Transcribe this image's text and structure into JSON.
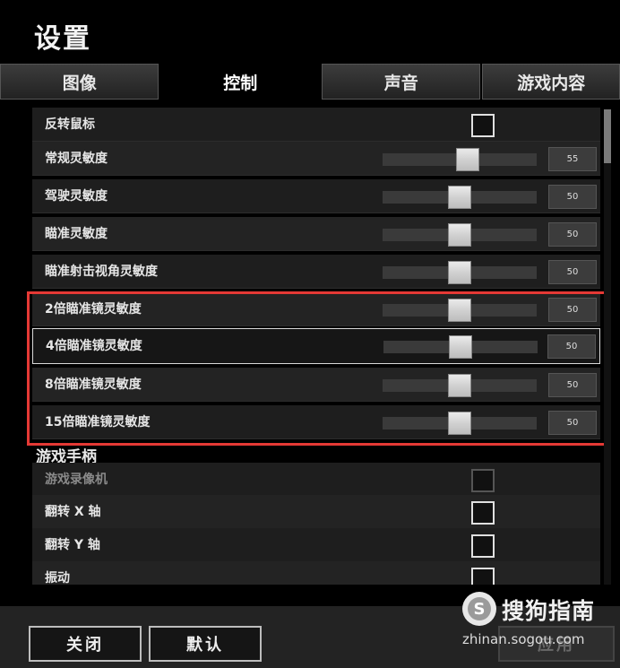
{
  "window": {
    "title": "设置"
  },
  "tabs": [
    {
      "label": "图像",
      "active": false
    },
    {
      "label": "控制",
      "active": true
    },
    {
      "label": "声音",
      "active": false
    },
    {
      "label": "游戏内容",
      "active": false
    }
  ],
  "settings": {
    "invert_mouse": {
      "label": "反转鼠标"
    },
    "general_sensitivity": {
      "label": "常规灵敏度",
      "value": "55",
      "fraction": 0.55
    },
    "driving_sensitivity": {
      "label": "驾驶灵敏度",
      "value": "50",
      "fraction": 0.5
    },
    "aim_sensitivity": {
      "label": "瞄准灵敏度",
      "value": "50",
      "fraction": 0.5
    },
    "ads_sensitivity": {
      "label": "瞄准射击视角灵敏度",
      "value": "50",
      "fraction": 0.5
    },
    "scope_2x": {
      "label": "2倍瞄准镜灵敏度",
      "value": "50",
      "fraction": 0.5
    },
    "scope_4x": {
      "label": "4倍瞄准镜灵敏度",
      "value": "50",
      "fraction": 0.5
    },
    "scope_8x": {
      "label": "8倍瞄准镜灵敏度",
      "value": "50",
      "fraction": 0.5
    },
    "scope_15x": {
      "label": "15倍瞄准镜灵敏度",
      "value": "50",
      "fraction": 0.5
    }
  },
  "gamepad": {
    "title": "游戏手柄",
    "recorder": {
      "label": "游戏录像机"
    },
    "flip_x": {
      "label": "翻转 X 轴"
    },
    "flip_y": {
      "label": "翻转 Y 轴"
    },
    "vibration": {
      "label": "振动"
    }
  },
  "buttons": {
    "close": "关闭",
    "default": "默认",
    "apply": "应用"
  },
  "watermark": {
    "name": "搜狗指南",
    "url": "zhinan.sogou.com",
    "logo_letter": "S"
  },
  "colors": {
    "highlight_border": "#e53935",
    "active_tab": "#000000"
  }
}
